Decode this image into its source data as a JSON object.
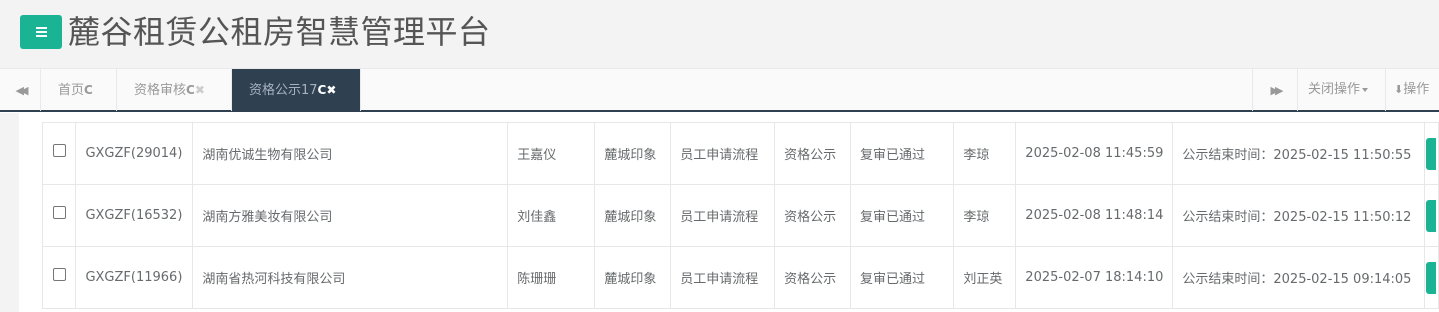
{
  "header": {
    "title": "麓谷租赁公租房智慧管理平台"
  },
  "tabs": [
    {
      "label": "首页",
      "active": false,
      "refresh_icon": "C",
      "closable": false
    },
    {
      "label": "资格审核",
      "active": false,
      "refresh_icon": "C",
      "closable": true
    },
    {
      "label": "资格公示17",
      "active": true,
      "refresh_icon": "C",
      "closable": true
    }
  ],
  "toolbar": {
    "close_ops_label": "关闭操作",
    "ops_label": "操作"
  },
  "icons": {
    "nav_left": "◀◀",
    "nav_right": "▶▶",
    "refresh": "C",
    "close": "✖",
    "download": "⬇"
  },
  "table": {
    "rows": [
      {
        "code": "GXGZF(29014)",
        "company": "湖南优诚生物有限公司",
        "applicant": "王嘉仪",
        "project": "麓城印象",
        "flow": "员工申请流程",
        "stage": "资格公示",
        "status": "复审已通过",
        "handler": "李琼",
        "time": "2025-02-08 11:45:59",
        "publicity_end": "公示结束时间：2025-02-15 11:50:55"
      },
      {
        "code": "GXGZF(16532)",
        "company": "湖南方雅美妆有限公司",
        "applicant": "刘佳鑫",
        "project": "麓城印象",
        "flow": "员工申请流程",
        "stage": "资格公示",
        "status": "复审已通过",
        "handler": "李琼",
        "time": "2025-02-08 11:48:14",
        "publicity_end": "公示结束时间：2025-02-15 11:50:12"
      },
      {
        "code": "GXGZF(11966)",
        "company": "湖南省热河科技有限公司",
        "applicant": "陈珊珊",
        "project": "麓城印象",
        "flow": "员工申请流程",
        "stage": "资格公示",
        "status": "复审已通过",
        "handler": "刘正英",
        "time": "2025-02-07 18:14:10",
        "publicity_end": "公示结束时间：2025-02-15 09:14:05"
      }
    ]
  },
  "colors": {
    "accent": "#1ab394",
    "active_tab": "#2f4050",
    "header_bg": "#f3f3f4"
  }
}
